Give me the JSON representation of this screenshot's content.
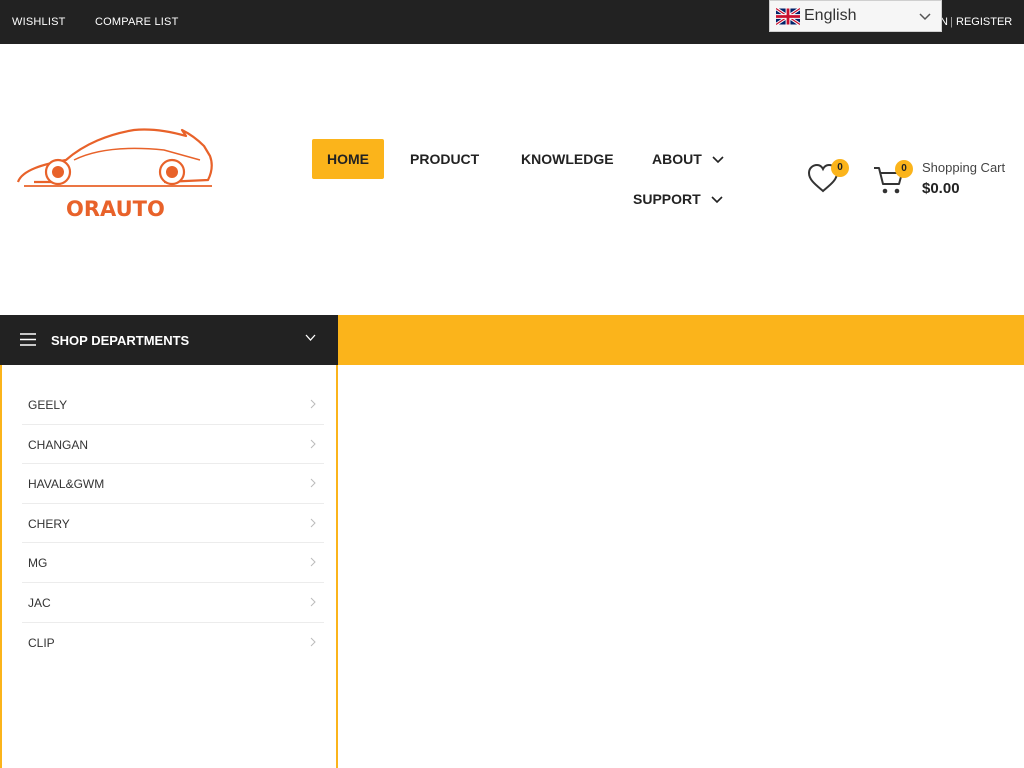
{
  "topbar": {
    "wishlist": "WISHLIST",
    "compare": "COMPARE LIST",
    "language": "English",
    "login_fragment": "N",
    "separator": "|",
    "register": "REGISTER"
  },
  "header": {
    "logo_text": "ORAUTO",
    "nav": [
      {
        "label": "HOME",
        "active": true
      },
      {
        "label": "PRODUCT"
      },
      {
        "label": "KNOWLEDGE"
      },
      {
        "label": "ABOUT"
      },
      {
        "label": "SUPPORT"
      }
    ],
    "wishlist_count": "0",
    "cart_count": "0",
    "cart_title": "Shopping Cart",
    "cart_total": "$0.00"
  },
  "departments": {
    "title": "SHOP DEPARTMENTS",
    "items": [
      "GEELY",
      "CHANGAN",
      "HAVAL&GWM",
      "CHERY",
      "MG",
      "JAC",
      "CLIP"
    ]
  },
  "colors": {
    "accent": "#fbb41b",
    "dark": "#222222",
    "logo": "#e8622a"
  }
}
